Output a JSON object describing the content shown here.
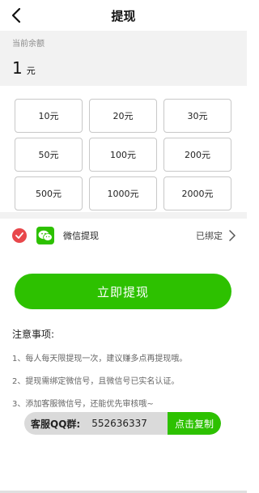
{
  "header": {
    "title": "提现"
  },
  "balance": {
    "label": "当前余额",
    "value": "1",
    "unit": "元"
  },
  "amounts": [
    "10元",
    "20元",
    "30元",
    "50元",
    "100元",
    "200元",
    "500元",
    "1000元",
    "2000元"
  ],
  "method": {
    "label": "微信提现",
    "status": "已绑定"
  },
  "action": {
    "withdraw_label": "立即提现"
  },
  "notes": {
    "title": "注意事项:",
    "items": [
      "1、每人每天限提现一次，建议赚多点再提现哦。",
      "2、提现需绑定微信号，且微信号已实名认证。",
      "3、添加客服微信号，还能优先审核哦~"
    ]
  },
  "support": {
    "label": "客服QQ群:",
    "number": "552636337",
    "copy_label": "点击复制"
  },
  "colors": {
    "accent": "#2dc100",
    "check": "#e8474b",
    "panel_bg": "#f2f2f2"
  },
  "icons": {
    "back": "chevron-left-icon",
    "check": "check-circle-icon",
    "wechat": "wechat-icon",
    "arrow": "chevron-right-icon"
  }
}
